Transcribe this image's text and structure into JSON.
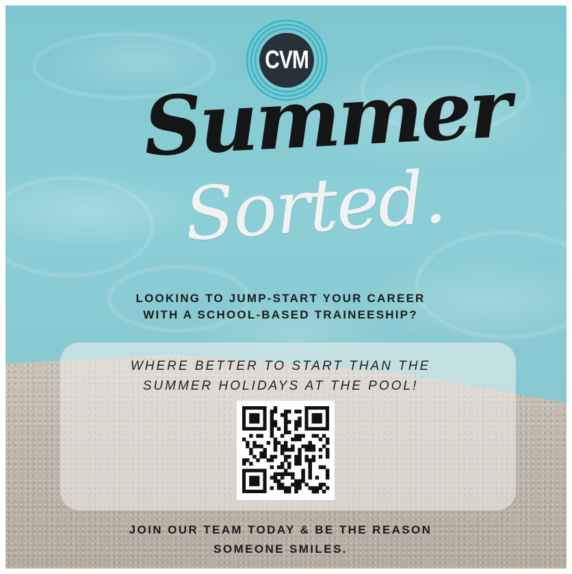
{
  "logo": {
    "text": "CVM",
    "ring_color": "#3bb8c8",
    "fill_color": "#26323a"
  },
  "title": {
    "line1": "Summer",
    "line2": "Sorted."
  },
  "heading": {
    "line1": "LOOKING TO JUMP-START YOUR CAREER",
    "line2": "WITH A SCHOOL-BASED TRAINEESHIP?"
  },
  "subheading": {
    "line1": "WHERE BETTER TO START THAN THE",
    "line2": "SUMMER HOLIDAYS AT THE POOL!"
  },
  "footer": {
    "line1": "JOIN OUR TEAM TODAY & BE THE REASON",
    "line2": "SOMEONE SMILES."
  },
  "colors": {
    "pool": "#86c9d1",
    "sand": "#bdb6aa",
    "text_dark": "#1a1a1a",
    "text_light": "#f2f2f2"
  }
}
